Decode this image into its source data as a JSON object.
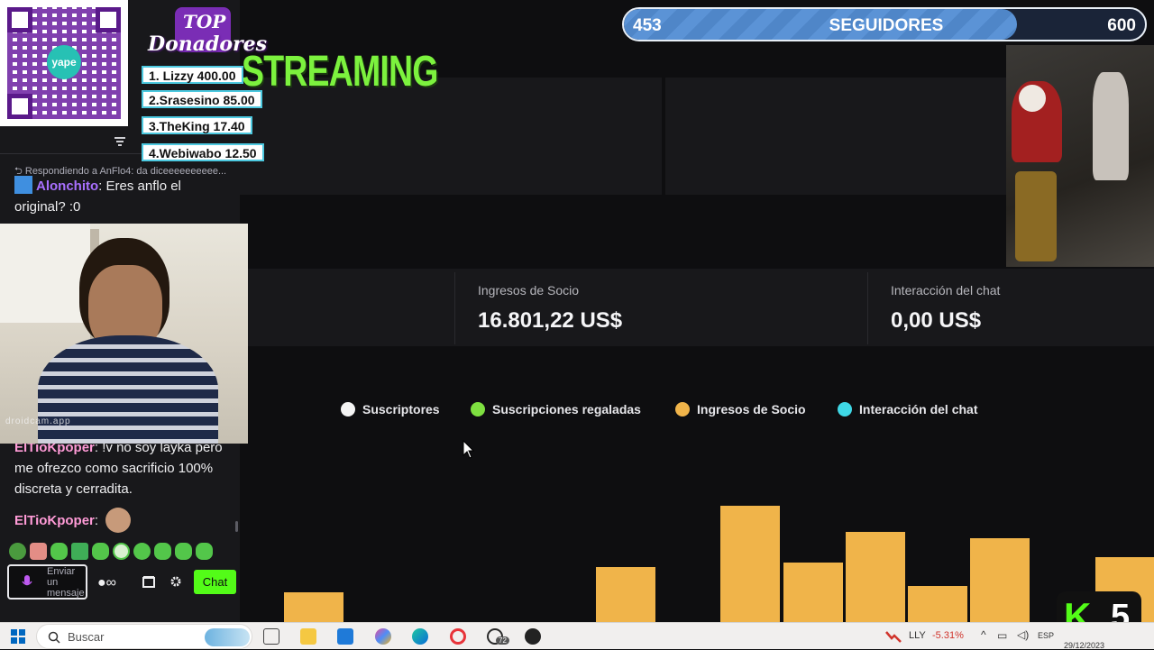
{
  "overlay": {
    "followers": {
      "current": "453",
      "label": "SEGUIDORES",
      "goal": "600",
      "progress": 0.755
    },
    "streaming_title": "STREAMING",
    "top_donors": {
      "title_line1": "TOP",
      "title_line2": "Donadores",
      "list": [
        "1. Lizzy 400.00",
        "2.Srasesino 85.00",
        "3.TheKing 17.40",
        "4.Webiwabo 12.50"
      ]
    },
    "qr": {
      "brand": "yape"
    },
    "corner_badge": {
      "letter": "K",
      "number": "5"
    },
    "webcam_watermark": "droidcam.app"
  },
  "stats": [
    {
      "label": "Ingresos de Socio",
      "value": "16.801,22 US$"
    },
    {
      "label": "Interacción del chat",
      "value": "0,00 US$"
    }
  ],
  "chart_data": {
    "type": "bar",
    "legend": [
      {
        "name": "Suscriptores",
        "color": "#f4f4f4"
      },
      {
        "name": "Suscripciones regaladas",
        "color": "#7ee040"
      },
      {
        "name": "Ingresos de Socio",
        "color": "#f0b44a"
      },
      {
        "name": "Interacción del chat",
        "color": "#3fd8e6"
      }
    ],
    "series": [
      {
        "name": "Ingresos de Socio",
        "values": [
          22,
          0,
          0,
          0,
          0,
          41,
          0,
          86,
          44,
          67,
          27,
          62,
          0,
          48
        ]
      }
    ]
  },
  "chat": {
    "reply_context": "Respondiendo a AnFlo4: da diceeeeeeeeee...",
    "messages": [
      {
        "user": "Alonchito",
        "text": " Eres anflo el original? :0"
      },
      {
        "user": "ElTioKpoper",
        "text": " !v no soy layka pero me ofrezco como sacrificio 100% discreta y cerradita."
      },
      {
        "user": "ElTioKpoper",
        "text": ""
      }
    ],
    "input_placeholder": "Enviar un mensaje",
    "chat_button": "Chat"
  },
  "taskbar": {
    "search_placeholder": "Buscar",
    "stock": {
      "ticker": "LLY",
      "change": "-5.31%"
    },
    "language": "ESP",
    "date": "29/12/2023",
    "whatsapp_badge": "72"
  },
  "colors": {
    "accent_green": "#7cf23e",
    "bar_orange": "#f0b44a",
    "twitch_purple": "#a970ff"
  }
}
